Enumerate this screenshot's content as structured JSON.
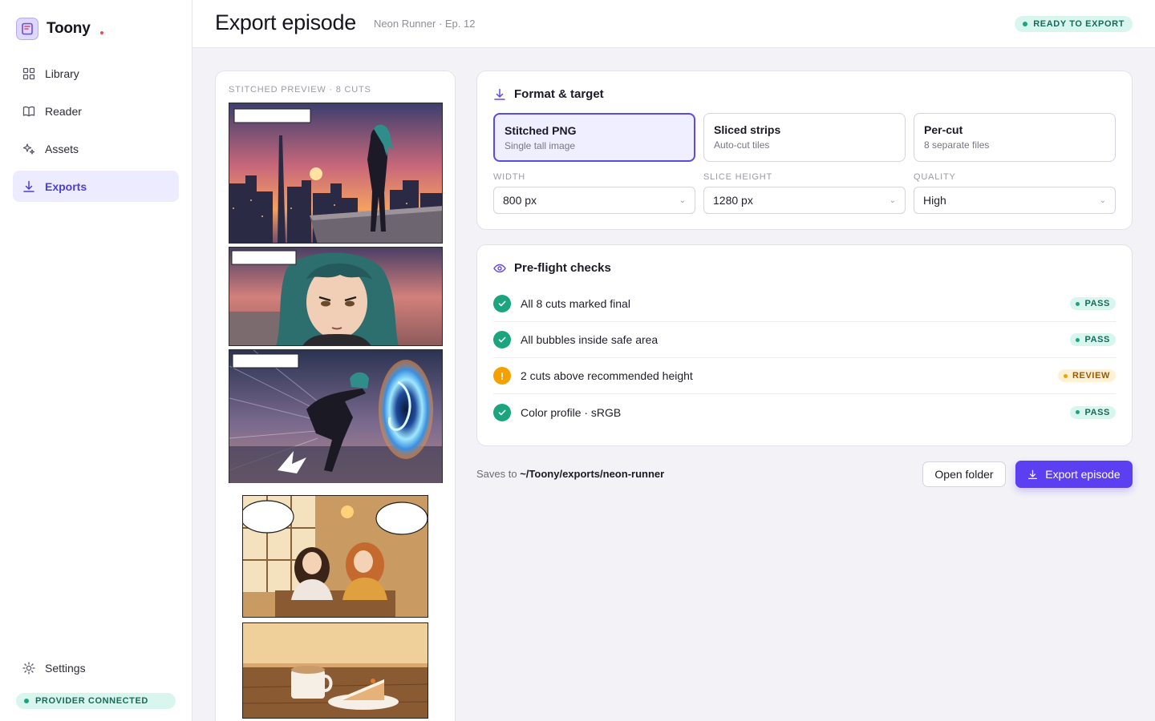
{
  "app": {
    "name": "Toony"
  },
  "sidebar": {
    "items": [
      {
        "label": "Library",
        "icon": "grid-icon",
        "active": false
      },
      {
        "label": "Reader",
        "icon": "book-icon",
        "active": false
      },
      {
        "label": "Assets",
        "icon": "sparkle-icon",
        "active": false
      },
      {
        "label": "Exports",
        "icon": "download-icon",
        "active": true
      }
    ],
    "settings_label": "Settings",
    "provider_status": "PROVIDER CONNECTED"
  },
  "header": {
    "title": "Export episode",
    "subtitle": "Neon Runner · Ep. 12",
    "status": "READY TO EXPORT"
  },
  "preview": {
    "label": "STITCHED PREVIEW · 8 CUTS"
  },
  "format": {
    "title": "Format & target",
    "options": [
      {
        "title": "Stitched PNG",
        "sub": "Single tall image",
        "selected": true
      },
      {
        "title": "Sliced strips",
        "sub": "Auto-cut tiles",
        "selected": false
      },
      {
        "title": "Per-cut",
        "sub": "8 separate files",
        "selected": false
      }
    ],
    "fields": [
      {
        "label": "WIDTH",
        "value": "800 px"
      },
      {
        "label": "SLICE HEIGHT",
        "value": "1280 px"
      },
      {
        "label": "QUALITY",
        "value": "High"
      }
    ]
  },
  "preflight": {
    "title": "Pre-flight checks",
    "checks": [
      {
        "text": "All 8 cuts marked final",
        "status": "PASS"
      },
      {
        "text": "All bubbles inside safe area",
        "status": "PASS"
      },
      {
        "text": "2 cuts above recommended height",
        "status": "REVIEW"
      },
      {
        "text": "Color profile · sRGB",
        "status": "PASS"
      }
    ]
  },
  "footer": {
    "saves_prefix": "Saves to",
    "path": "~/Toony/exports/neon-runner",
    "open_label": "Open folder",
    "export_label": "Export episode"
  },
  "colors": {
    "accent": "#5b3ff0",
    "pass": "#1aa57f",
    "review": "#f4a100"
  }
}
